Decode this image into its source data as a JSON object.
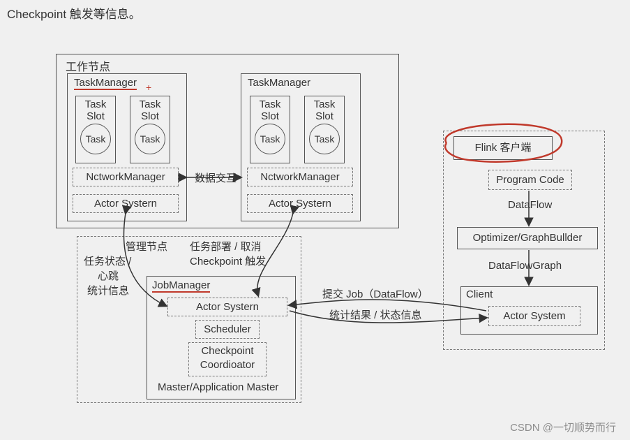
{
  "title": "Checkpoint 触发等信息。",
  "worker_node_label": "工作节点",
  "task_manager": "TaskManager",
  "task": "Task",
  "slot": "Slot",
  "task_circle": "Task",
  "plus": "+",
  "network_manager": "NctworkManager",
  "actor_system": "Actor Systern",
  "data_exchange": "数据交互",
  "mgmt_node": "管理节点",
  "task_status": "任务状态 /",
  "heartbeat": "心跳",
  "stats": "统计信息",
  "task_deploy": "任务部署 / 取消",
  "checkpoint_trigger": "Checkpoint 触发",
  "job_manager": "JobManager",
  "actor_system_jm": "Actor Systern",
  "scheduler": "Scheduler",
  "checkpoint_coord1": "Checkpoint",
  "checkpoint_coord2": "Coordioator",
  "master_app": "Master/Application Master",
  "flink_client": "Flink 客户端",
  "program_code": "Program Code",
  "dataflow": "DataFlow",
  "optimizer": "Optimizer/GraphBullder",
  "dataflowgraph": "DataFlowGraph",
  "client": "Client",
  "actor_system_client": "Actor System",
  "submit_job": "提交 Job（DataFlow）",
  "stats_result": "统计结果 / 状态信息",
  "watermark": "CSDN @一切顺势而行"
}
